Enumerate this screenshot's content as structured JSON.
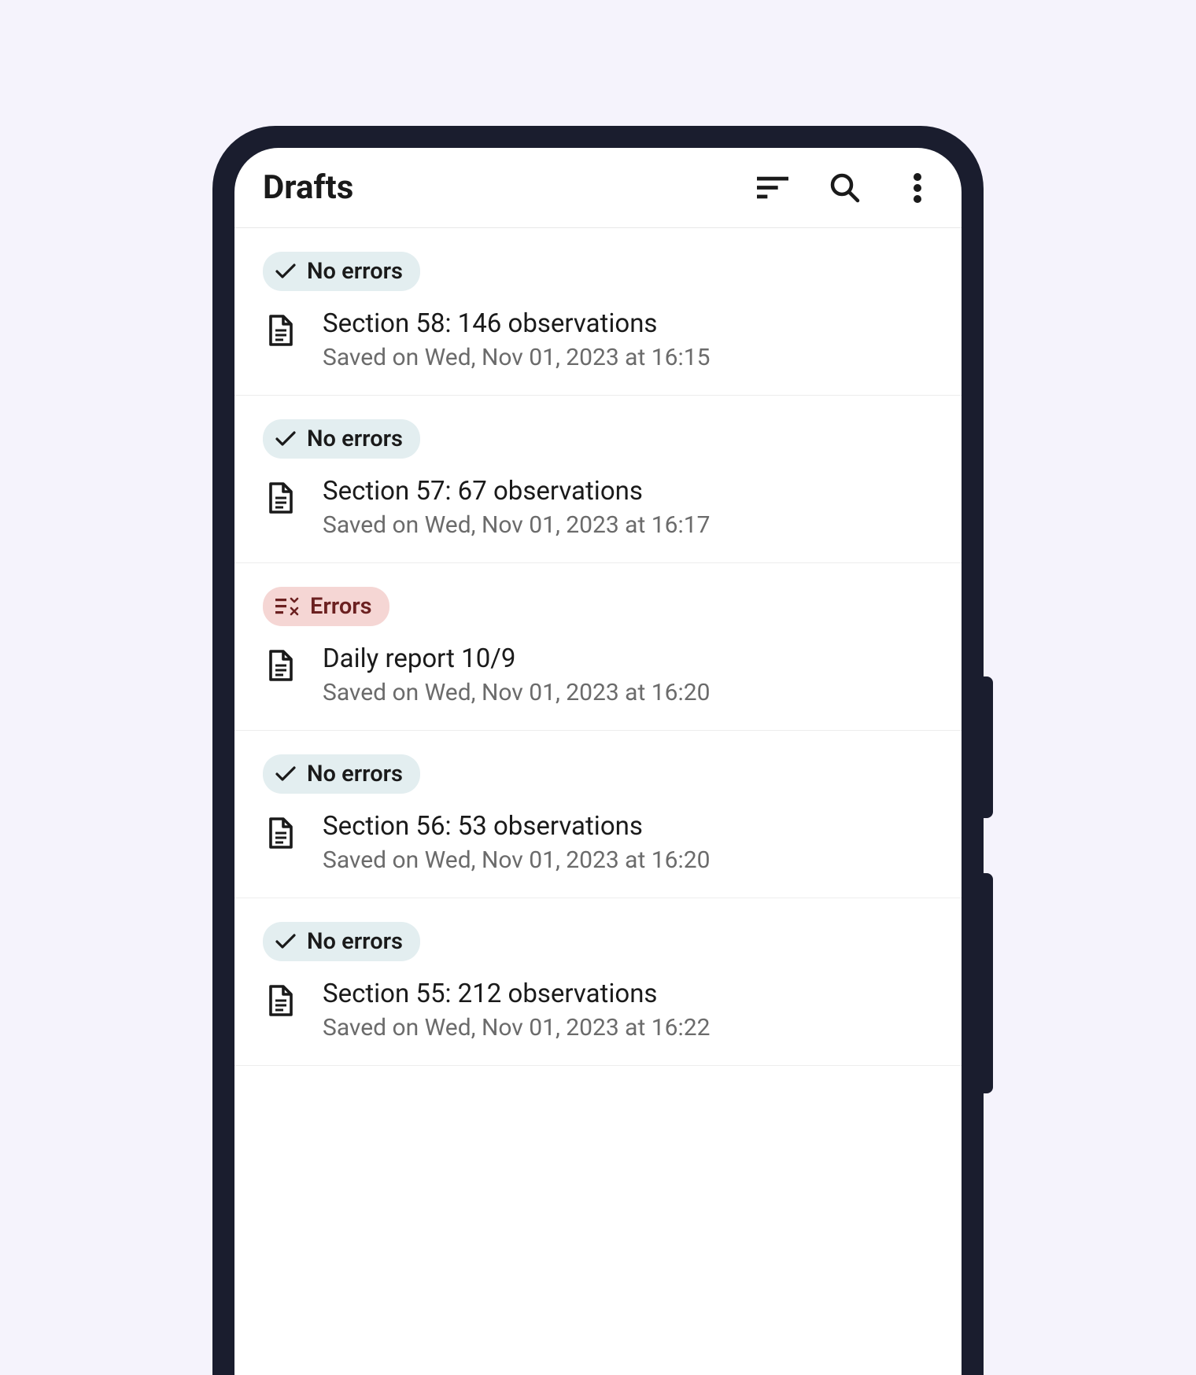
{
  "header": {
    "title": "Drafts"
  },
  "status_labels": {
    "no_errors": "No errors",
    "errors": "Errors"
  },
  "drafts": [
    {
      "status": "no_errors",
      "title": "Section 58: 146 observations",
      "saved": "Saved on Wed, Nov 01, 2023 at 16:15"
    },
    {
      "status": "no_errors",
      "title": "Section 57: 67 observations",
      "saved": "Saved on Wed, Nov 01, 2023 at 16:17"
    },
    {
      "status": "errors",
      "title": "Daily report 10/9",
      "saved": "Saved on Wed, Nov 01, 2023 at 16:20"
    },
    {
      "status": "no_errors",
      "title": "Section 56: 53 observations",
      "saved": "Saved on Wed, Nov 01, 2023 at 16:20"
    },
    {
      "status": "no_errors",
      "title": "Section 55: 212 observations",
      "saved": "Saved on Wed, Nov 01, 2023 at 16:22"
    }
  ]
}
